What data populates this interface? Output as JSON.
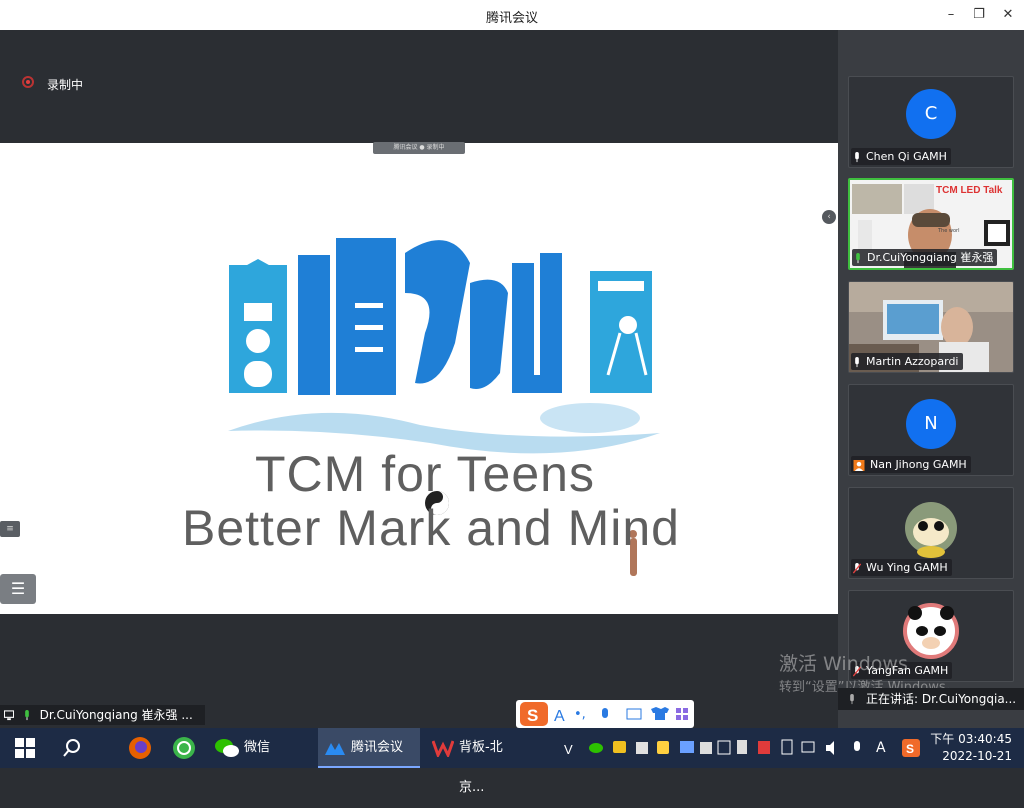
{
  "window": {
    "title": "腾讯会议",
    "minimize_glyph": "–",
    "restore_glyph": "❐",
    "close_glyph": "✕"
  },
  "recording": {
    "label": "录制中"
  },
  "share_tag": {
    "text": "腾讯会议  ●  录制中"
  },
  "slide": {
    "logo_line1": "TCM  for Teens",
    "logo_line2": "Better Mark and Mind",
    "brand_colors": {
      "primary": "#1f7fd6",
      "light": "#2ea6dc",
      "text": "#5f5f5f"
    }
  },
  "toggles": {
    "small": "≡",
    "large": "☰",
    "collapse": "‹"
  },
  "active_speaker": {
    "name": "Dr.CuiYongqiang 崔永强 ..."
  },
  "participants": [
    {
      "name": "Chen Qi GAMH",
      "avatar": "C",
      "avatar_color": "#1170f0",
      "video": false,
      "icon": "mic-icon"
    },
    {
      "name": "Dr.CuiYongqiang 崔永强",
      "video": true,
      "active": true,
      "icon": "mic-active-icon",
      "video_label": "TCM LED Talk"
    },
    {
      "name": "Martin Azzopardi",
      "video": true,
      "icon": "mic-icon"
    },
    {
      "name": "Nan Jihong  GAMH",
      "avatar": "N",
      "avatar_color": "#1170f0",
      "video": false,
      "icon": "person-icon"
    },
    {
      "name": "Wu Ying GAMH",
      "video": false,
      "icon": "mic-muted-icon",
      "photo": "dog-avatar"
    },
    {
      "name": "YangFan GAMH",
      "video": false,
      "icon": "mic-muted-icon",
      "photo": "panda-avatar"
    }
  ],
  "watermark": {
    "line1": "激活 Windows",
    "line2": "转到“设置”以激活 Windows。"
  },
  "talking": {
    "label": "正在讲话: Dr.CuiYongqia..."
  },
  "ime": {
    "letter": "A",
    "punct": "•,"
  },
  "taskbar": {
    "wechat": "微信",
    "meeting": "腾讯会议",
    "wps": "背板-北京...",
    "ime_char": "A",
    "time": "下午 03:40:45",
    "date": "2022-10-21"
  }
}
